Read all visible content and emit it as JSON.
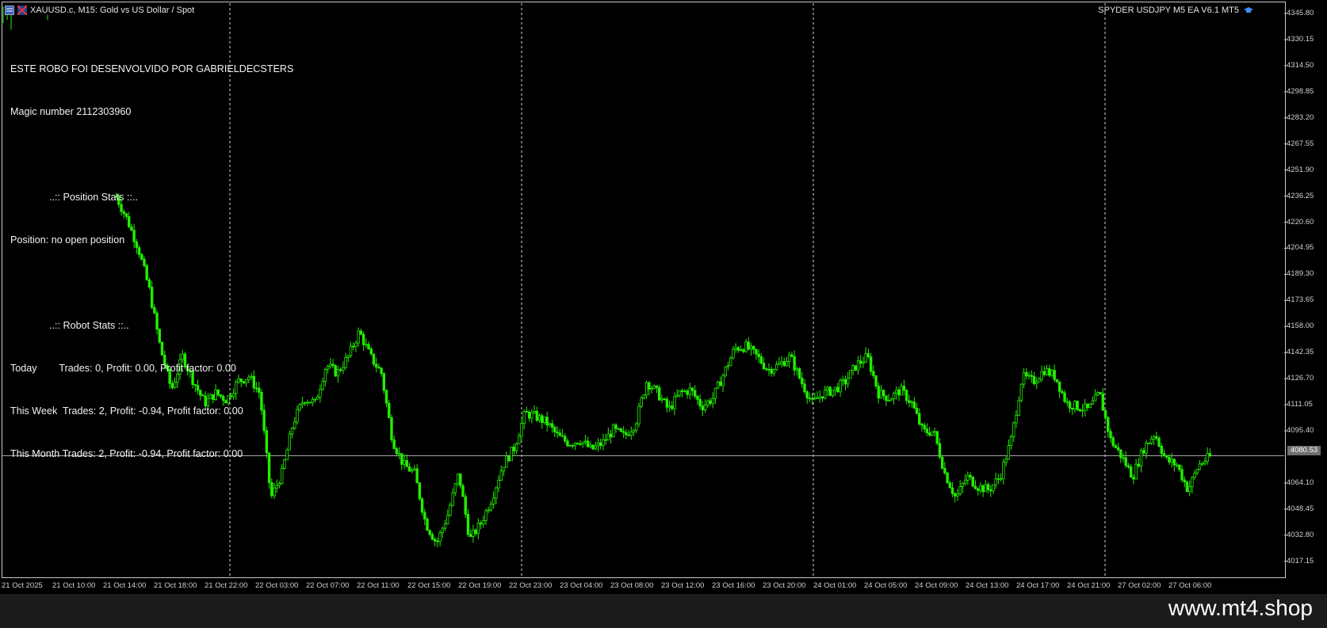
{
  "window": {
    "symbol_title": "XAUUSD.c, M15:  Gold vs US Dollar / Spot",
    "ea_name": "SPYDER USDJPY M5 EA V6.1 MT5"
  },
  "info_panel": {
    "lines": [
      "ESTE ROBO FOI DESENVOLVIDO POR GABRIELDECSTERS",
      "Magic number 2112303960",
      "",
      "              ..:: Position Stats ::..",
      "Position: no open position",
      "",
      "              ..:: Robot Stats ::..",
      "Today        Trades: 0, Profit: 0.00, Profit factor: 0.00",
      "This Week  Trades: 2, Profit: -0.94, Profit factor: 0.00",
      "This Month Trades: 2, Profit: -0.94, Profit factor: 0.00"
    ]
  },
  "price_axis": {
    "ticks": [
      "4345.80",
      "4330.15",
      "4314.50",
      "4298.85",
      "4283.20",
      "4267.55",
      "4251.90",
      "4236.25",
      "4220.60",
      "4204.95",
      "4189.30",
      "4173.65",
      "4158.00",
      "4142.35",
      "4126.70",
      "4111.05",
      "4095.40",
      "4064.10",
      "4048.45",
      "4032.80",
      "4017.15"
    ],
    "current_price": "4080.53"
  },
  "time_axis": {
    "labels": [
      "21 Oct 2025",
      "21 Oct 10:00",
      "21 Oct 14:00",
      "21 Oct 18:00",
      "21 Oct 22:00",
      "22 Oct 03:00",
      "22 Oct 07:00",
      "22 Oct 11:00",
      "22 Oct 15:00",
      "22 Oct 19:00",
      "22 Oct 23:00",
      "23 Oct 04:00",
      "23 Oct 08:00",
      "23 Oct 12:00",
      "23 Oct 16:00",
      "23 Oct 20:00",
      "24 Oct 01:00",
      "24 Oct 05:00",
      "24 Oct 09:00",
      "24 Oct 13:00",
      "24 Oct 17:00",
      "24 Oct 21:00",
      "27 Oct 02:00",
      "27 Oct 06:00"
    ]
  },
  "colors": {
    "background": "#000000",
    "candle": "#22ee00",
    "text": "#f2f2f2",
    "grid_separator": "#ffffff",
    "price_line": "#b0b0b0"
  },
  "chart_data": {
    "type": "candlestick",
    "timeframe": "M15",
    "symbol": "XAUUSD.c",
    "ylim": [
      4008.0,
      4352.0
    ],
    "close_path": [
      [
        "21 Oct 14:00",
        4236
      ],
      [
        "21 Oct 14:30",
        4222
      ],
      [
        "21 Oct 15:00",
        4205
      ],
      [
        "21 Oct 15:30",
        4180
      ],
      [
        "21 Oct 16:00",
        4145
      ],
      [
        "21 Oct 16:30",
        4120
      ],
      [
        "21 Oct 17:00",
        4140
      ],
      [
        "21 Oct 17:30",
        4125
      ],
      [
        "21 Oct 18:00",
        4112
      ],
      [
        "21 Oct 19:00",
        4118
      ],
      [
        "21 Oct 20:00",
        4114
      ],
      [
        "21 Oct 21:00",
        4125
      ],
      [
        "21 Oct 22:00",
        4128
      ],
      [
        "21 Oct 23:00",
        4118
      ],
      [
        "22 Oct 00:00",
        4055
      ],
      [
        "22 Oct 00:30",
        4070
      ],
      [
        "22 Oct 01:30",
        4100
      ],
      [
        "22 Oct 02:30",
        4115
      ],
      [
        "22 Oct 03:30",
        4112
      ],
      [
        "22 Oct 04:30",
        4135
      ],
      [
        "22 Oct 05:30",
        4130
      ],
      [
        "22 Oct 06:30",
        4140
      ],
      [
        "22 Oct 07:00",
        4155
      ],
      [
        "22 Oct 07:30",
        4140
      ],
      [
        "22 Oct 08:00",
        4130
      ],
      [
        "22 Oct 09:00",
        4090
      ],
      [
        "22 Oct 10:00",
        4075
      ],
      [
        "22 Oct 11:00",
        4070
      ],
      [
        "22 Oct 12:00",
        4040
      ],
      [
        "22 Oct 13:00",
        4028
      ],
      [
        "22 Oct 14:00",
        4045
      ],
      [
        "22 Oct 15:00",
        4070
      ],
      [
        "22 Oct 16:00",
        4030
      ],
      [
        "22 Oct 17:00",
        4040
      ],
      [
        "22 Oct 18:00",
        4055
      ],
      [
        "22 Oct 19:00",
        4075
      ],
      [
        "22 Oct 20:00",
        4085
      ],
      [
        "22 Oct 21:00",
        4106
      ],
      [
        "22 Oct 22:00",
        4104
      ],
      [
        "22 Oct 23:00",
        4100
      ],
      [
        "23 Oct 00:00",
        4092
      ],
      [
        "23 Oct 01:00",
        4088
      ],
      [
        "23 Oct 02:00",
        4090
      ],
      [
        "23 Oct 03:00",
        4084
      ],
      [
        "23 Oct 04:00",
        4088
      ],
      [
        "23 Oct 05:00",
        4096
      ],
      [
        "23 Oct 06:00",
        4092
      ],
      [
        "23 Oct 07:00",
        4100
      ],
      [
        "23 Oct 07:30",
        4125
      ],
      [
        "23 Oct 08:30",
        4118
      ],
      [
        "23 Oct 09:30",
        4108
      ],
      [
        "23 Oct 10:30",
        4118
      ],
      [
        "23 Oct 11:30",
        4120
      ],
      [
        "23 Oct 12:30",
        4110
      ],
      [
        "23 Oct 13:30",
        4115
      ],
      [
        "23 Oct 14:30",
        4130
      ],
      [
        "23 Oct 15:30",
        4145
      ],
      [
        "23 Oct 16:30",
        4146
      ],
      [
        "23 Oct 17:30",
        4140
      ],
      [
        "23 Oct 18:30",
        4132
      ],
      [
        "23 Oct 19:30",
        4135
      ],
      [
        "23 Oct 20:30",
        4140
      ],
      [
        "23 Oct 21:30",
        4125
      ],
      [
        "23 Oct 22:30",
        4112
      ],
      [
        "23 Oct 23:30",
        4118
      ],
      [
        "24 Oct 00:30",
        4120
      ],
      [
        "24 Oct 01:30",
        4125
      ],
      [
        "24 Oct 02:30",
        4135
      ],
      [
        "24 Oct 03:30",
        4140
      ],
      [
        "24 Oct 04:30",
        4118
      ],
      [
        "24 Oct 05:30",
        4115
      ],
      [
        "24 Oct 06:30",
        4120
      ],
      [
        "24 Oct 07:30",
        4112
      ],
      [
        "24 Oct 08:30",
        4095
      ],
      [
        "24 Oct 09:30",
        4095
      ],
      [
        "24 Oct 10:30",
        4070
      ],
      [
        "24 Oct 11:30",
        4055
      ],
      [
        "24 Oct 12:30",
        4068
      ],
      [
        "24 Oct 13:30",
        4062
      ],
      [
        "24 Oct 14:30",
        4060
      ],
      [
        "24 Oct 15:30",
        4068
      ],
      [
        "24 Oct 16:30",
        4090
      ],
      [
        "24 Oct 17:30",
        4128
      ],
      [
        "24 Oct 18:30",
        4125
      ],
      [
        "24 Oct 19:30",
        4132
      ],
      [
        "24 Oct 20:30",
        4128
      ],
      [
        "24 Oct 21:30",
        4112
      ],
      [
        "24 Oct 22:30",
        4110
      ],
      [
        "24 Oct 23:30",
        4108
      ],
      [
        "27 Oct 00:30",
        4118
      ],
      [
        "27 Oct 01:30",
        4090
      ],
      [
        "27 Oct 02:30",
        4080
      ],
      [
        "27 Oct 03:30",
        4068
      ],
      [
        "27 Oct 04:30",
        4085
      ],
      [
        "27 Oct 05:30",
        4094
      ],
      [
        "27 Oct 06:30",
        4078
      ],
      [
        "27 Oct 07:30",
        4075
      ],
      [
        "27 Oct 08:30",
        4060
      ],
      [
        "27 Oct 09:30",
        4075
      ],
      [
        "27 Oct 10:30",
        4080
      ]
    ]
  }
}
